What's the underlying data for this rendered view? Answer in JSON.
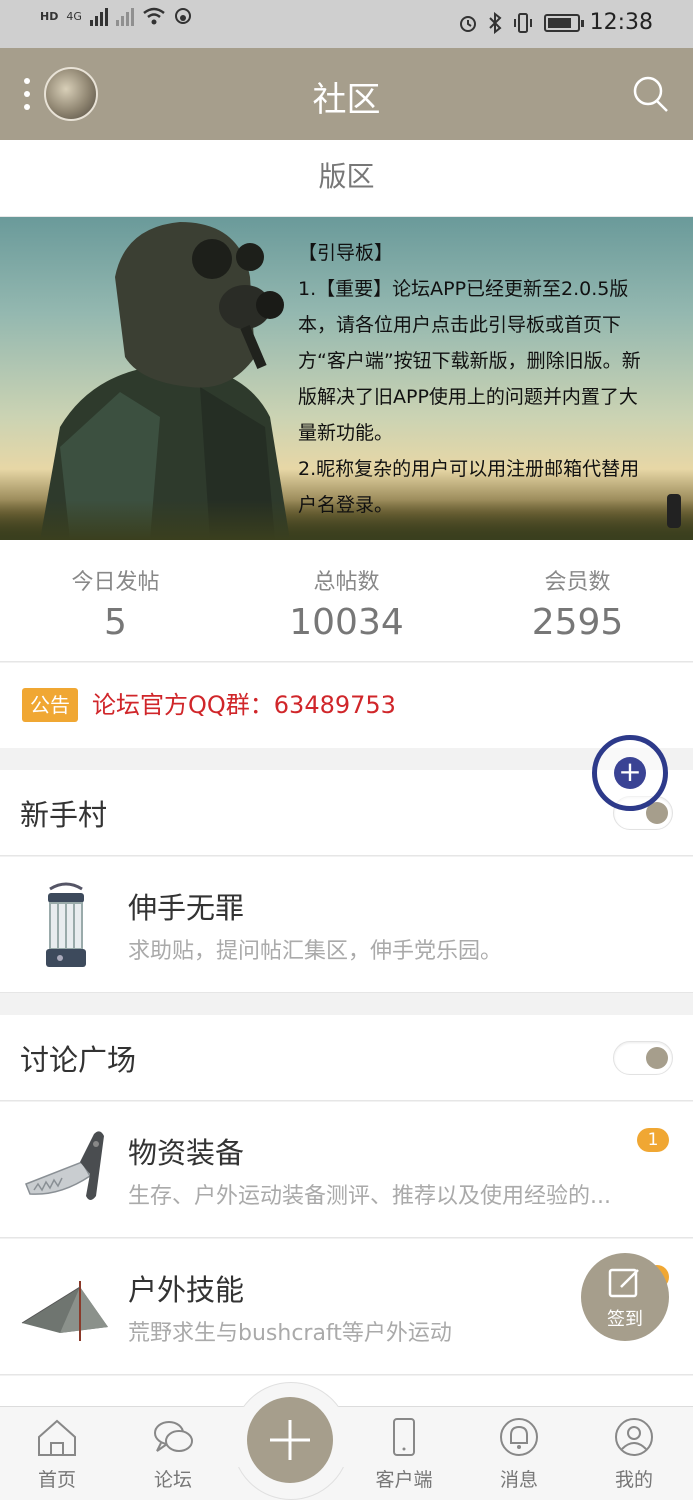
{
  "status_bar": {
    "network_labels": [
      "HD",
      "4G"
    ],
    "time": "12:38"
  },
  "header": {
    "title": "社区"
  },
  "section": {
    "title": "版区"
  },
  "banner": {
    "lines": [
      "【引导板】",
      "1.【重要】论坛APP已经更新至2.0.5版",
      "本，请各位用户点击此引导板或首页下",
      "方“客户端”按钮下载新版，删除旧版。新",
      "版解决了旧APP使用上的问题并内置了大",
      "量新功能。",
      "2.昵称复杂的用户可以用注册邮箱代替用",
      "户名登录。"
    ]
  },
  "stats": [
    {
      "label": "今日发帖",
      "value": "5"
    },
    {
      "label": "总帖数",
      "value": "10034"
    },
    {
      "label": "会员数",
      "value": "2595"
    }
  ],
  "notice": {
    "badge": "公告",
    "text": "论坛官方QQ群：",
    "number": "63489753"
  },
  "groups": [
    {
      "title": "新手村"
    },
    {
      "title": "讨论广场"
    }
  ],
  "forums": [
    {
      "name": "伸手无罪",
      "desc": "求助贴，提问帖汇集区，伸手党乐园。",
      "icon": "lantern-icon"
    },
    {
      "name": "物资装备",
      "desc": "生存、户外运动装备测评、推荐以及使用经验的...",
      "icon": "knife-icon",
      "badge": "1"
    },
    {
      "name": "户外技能",
      "desc": "荒野求生与bushcraft等户外运动",
      "icon": "tent-icon"
    }
  ],
  "checkin": {
    "label": "签到"
  },
  "fab": {
    "symbol": "+"
  },
  "bottom_nav": [
    {
      "label": "首页",
      "icon": "home-icon"
    },
    {
      "label": "论坛",
      "icon": "chat-icon"
    },
    {
      "label": "客户端",
      "icon": "phone-icon"
    },
    {
      "label": "消息",
      "icon": "bell-icon"
    },
    {
      "label": "我的",
      "icon": "user-icon"
    }
  ],
  "colors": {
    "theme": "#a69e8c",
    "notice_red": "#d0262a",
    "badge_orange": "#f0a733",
    "status_bar": "#cfcfcf"
  }
}
